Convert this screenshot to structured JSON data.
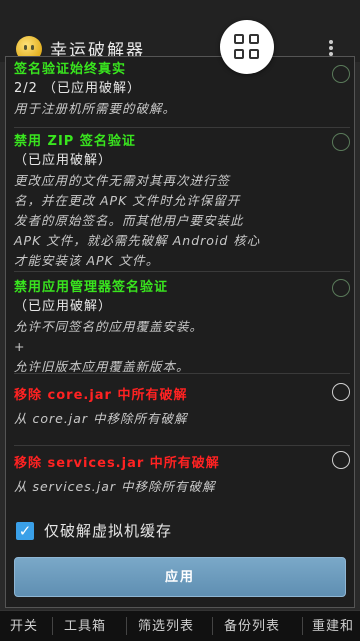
{
  "app": {
    "title": "幸运破解器"
  },
  "dialog": {
    "options": [
      {
        "title": "签名验证始终真实",
        "status": "2/2 （已应用破解）",
        "description": "用于注册机所需要的破解。",
        "title_color": "#39e51e"
      },
      {
        "title": "禁用 ZIP 签名验证",
        "status": "（已应用破解）",
        "description": "更改应用的文件无需对其再次进行签\n名，并在更改 APK 文件时允许保留开\n发者的原始签名。而其他用户要安装此\nAPK 文件，就必需先破解 Android 核心\n才能安装该 APK 文件。",
        "title_color": "#39e51e"
      },
      {
        "title": "禁用应用管理器签名验证",
        "status": "（已应用破解）",
        "description": "允许不同签名的应用覆盖安装。\n+\n允许旧版本应用覆盖新版本。",
        "title_color": "#39e51e"
      },
      {
        "title": "移除 core.jar 中所有破解",
        "description": "从 core.jar 中移除所有破解",
        "title_color": "#ff2222"
      },
      {
        "title": "移除 services.jar 中所有破解",
        "description": "从 services.jar 中移除所有破解",
        "title_color": "#ff2222"
      }
    ],
    "checkbox": {
      "label": "仅破解虚拟机缓存",
      "checked": true
    },
    "apply_label": "应用"
  },
  "tabs": [
    "开关",
    "工具箱",
    "筛选列表",
    "备份列表",
    "重建和"
  ]
}
